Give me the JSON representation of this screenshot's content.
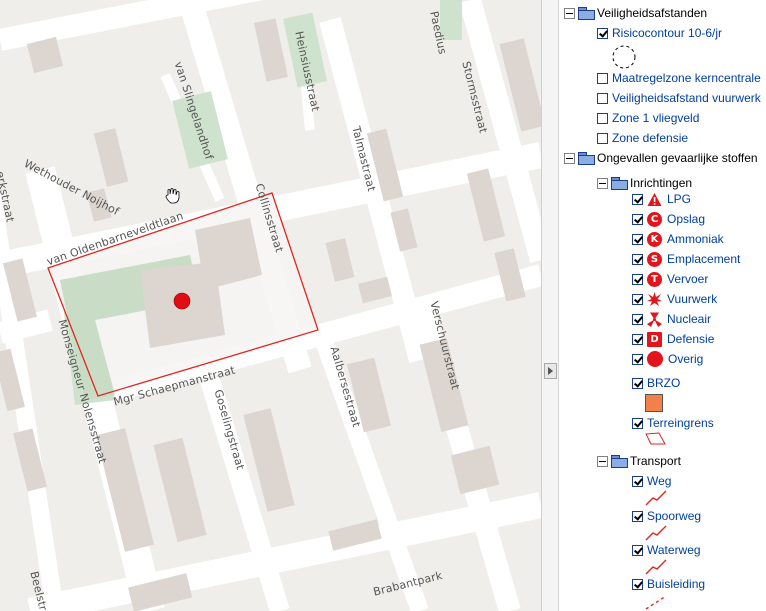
{
  "map": {
    "streets": {
      "van_slingelandhof": "van Slingelandhof",
      "heinsiusstraat": "Heinsiusstraat",
      "paediusstr": "Paedius",
      "stormsstraat": "Stormsstraat",
      "talmastraat": "Talmastraat",
      "wethouder_nolhof": "Wethouder Noijhof",
      "kerkstraat": "erkstraat",
      "van_oldenbarneveldtlaan": "van Oldenbarneveldtlaan",
      "collinsstraat": "Collinsstraat",
      "monseigneur_nolensstraat": "Monseigneur Nolensstraat",
      "mgr_schaepmanstraat": "Mgr Schaepmanstraat",
      "aalbersestraat": "Aalbersestraat",
      "verschuurstraat": "Verschuurstraat",
      "goselingstraat": "Goselingstraat",
      "brabantpark": "Brabantpark",
      "beelstraat": "Beelstr"
    },
    "risk_object": "Overig",
    "colors": {
      "terrain_border": "#e0261f",
      "risk_dot": "#e00d12",
      "park": "#c8dfc8"
    }
  },
  "legend": {
    "veiligheidsafstanden": {
      "label": "Veiligheidsafstanden",
      "items": [
        {
          "label": "Risicocontour 10-6/jr",
          "checked": true
        },
        {
          "label": "Maatregelzone kerncentrale",
          "checked": false
        },
        {
          "label": "Veiligheidsafstand vuurwerk",
          "checked": false
        },
        {
          "label": "Zone 1 vliegveld",
          "checked": false
        },
        {
          "label": "Zone defensie",
          "checked": false
        }
      ]
    },
    "ongevallen": {
      "label": "Ongevallen gevaarlijke stoffen",
      "inrichtingen": {
        "label": "Inrichtingen",
        "items": [
          {
            "label": "LPG",
            "icon": "lpg-triangle-icon",
            "letter": "!"
          },
          {
            "label": "Opslag",
            "icon": "opslag-c-icon",
            "letter": "C"
          },
          {
            "label": "Ammoniak",
            "icon": "ammoniak-k-icon",
            "letter": "K"
          },
          {
            "label": "Emplacement",
            "icon": "emplacement-s-icon",
            "letter": "S"
          },
          {
            "label": "Vervoer",
            "icon": "vervoer-t-icon",
            "letter": "T"
          },
          {
            "label": "Vuurwerk",
            "icon": "vuurwerk-explosion-icon",
            "letter": ""
          },
          {
            "label": "Nucleair",
            "icon": "nucleair-trefoil-icon",
            "letter": ""
          },
          {
            "label": "Defensie",
            "icon": "defensie-d-icon",
            "letter": "D"
          },
          {
            "label": "Overig",
            "icon": "overig-dot-icon",
            "letter": ""
          }
        ]
      },
      "brzo": {
        "label": "BRZO",
        "color": "#f2804a"
      },
      "terreingrens": {
        "label": "Terreingrens"
      },
      "transport": {
        "label": "Transport",
        "items": [
          {
            "label": "Weg"
          },
          {
            "label": "Spoorweg"
          },
          {
            "label": "Waterweg"
          },
          {
            "label": "Buisleiding"
          }
        ]
      }
    }
  }
}
